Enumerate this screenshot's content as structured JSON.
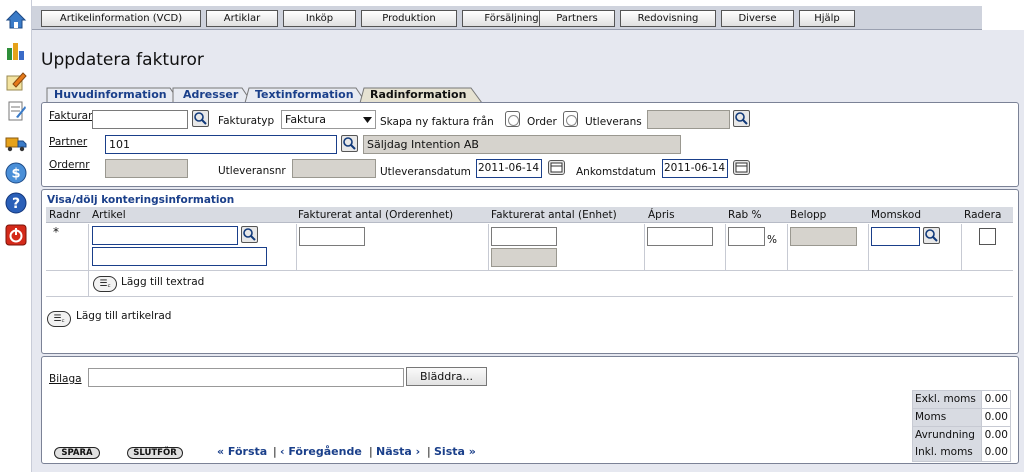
{
  "menu": {
    "items": [
      "Artikelinformation (VCD)",
      "Artiklar",
      "Inköp",
      "Produktion",
      "Försäljning",
      "Partners",
      "Redovisning",
      "Diverse",
      "Hjälp"
    ]
  },
  "page": {
    "title": "Uppdatera fakturor"
  },
  "tabs": [
    "Huvudinformation",
    "Adresser",
    "Textinformation",
    "Radinformation"
  ],
  "form": {
    "fakturanr_label": "Fakturanr",
    "fakturanr_value": "",
    "fakturatyp_label": "Fakturatyp",
    "fakturatyp_value": "Faktura",
    "skapa_label": "Skapa ny faktura från",
    "order_label": "Order",
    "utleverans_label": "Utleverans",
    "utleverans_value": "",
    "partner_label": "Partner",
    "partner_value": "101",
    "partner_name": "Säljdag Intention AB",
    "ordernr_label": "Ordernr",
    "ordernr_value": "",
    "utleveransnr_label": "Utleveransnr",
    "utleveransnr_value": "",
    "utleveransdatum_label": "Utleveransdatum",
    "utleveransdatum_value": "2011-06-14",
    "ankomstdatum_label": "Ankomstdatum",
    "ankomstdatum_value": "2011-06-14"
  },
  "rows": {
    "toggle_label": "Visa/dölj konteringsinformation",
    "columns": [
      "Radnr",
      "Artikel",
      "Fakturerat antal (Orderenhet)",
      "Fakturerat antal (Enhet)",
      "Ápris",
      "Rab %",
      "Belopp",
      "Momskod",
      "Radera"
    ],
    "new_row_marker": "*",
    "percent_sign": "%",
    "add_text_row": "Lägg till textrad",
    "add_article_row": "Lägg till artikelrad",
    "add_btn_glyph": "☰꜀"
  },
  "bottom": {
    "bilaga_label": "Bilaga",
    "bilaga_value": "",
    "browse_label": "Bläddra...",
    "save_label": "SPARA",
    "finish_label": "SLUTFÖR",
    "nav_first": "« Första",
    "nav_prev": "‹ Föregående",
    "nav_next": "Nästa ›",
    "nav_last": "Sista »",
    "nav_sep": "|"
  },
  "totals": [
    {
      "label": "Exkl. moms",
      "value": "0.00"
    },
    {
      "label": "Moms",
      "value": "0.00"
    },
    {
      "label": "Avrundning",
      "value": "0.00"
    },
    {
      "label": "Inkl. moms",
      "value": "0.00"
    }
  ],
  "sidebar_icons": [
    "home-icon",
    "chart-icon",
    "edit-icon",
    "document-icon",
    "truck-icon",
    "dollar-icon",
    "help-icon",
    "power-icon"
  ],
  "colors": {
    "accent": "#1a3f8a",
    "sidebar_bg": "#ffffff",
    "panel_border": "#7b8296"
  }
}
